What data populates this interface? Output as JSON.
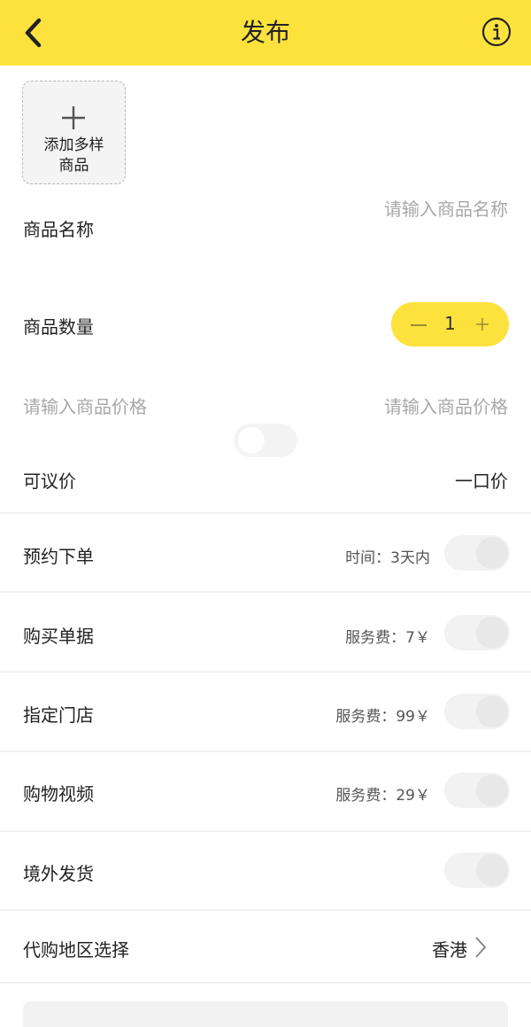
{
  "header": {
    "title": "发布",
    "back_icon": "chevron-left-icon",
    "info_icon": "info-circle-icon",
    "bg_color": "#fde23d"
  },
  "add_product": {
    "label": "添加多样商品",
    "icon": "plus-icon"
  },
  "form": {
    "name_label": "商品名称",
    "name_placeholder": "请输入商品名称",
    "quantity_label": "商品数量",
    "quantity_value": "1",
    "price_placeholder_left": "请输入商品价格",
    "price_placeholder_right": "请输入商品价格",
    "negotiable_label": "可议价",
    "fixed_price_label": "一口价"
  },
  "options": [
    {
      "label": "预约下单",
      "detail": "时间：3天内",
      "toggle": false
    },
    {
      "label": "购买单据",
      "detail": "服务费：7￥",
      "toggle": false
    },
    {
      "label": "指定门店",
      "detail": "服务费：99￥",
      "toggle": false
    },
    {
      "label": "购物视频",
      "detail": "服务费：29￥",
      "toggle": false
    },
    {
      "label": "境外发货",
      "detail": "",
      "toggle": false
    }
  ],
  "region": {
    "label": "代购地区选择",
    "value": "香港",
    "icon": "chevron-right-icon"
  }
}
